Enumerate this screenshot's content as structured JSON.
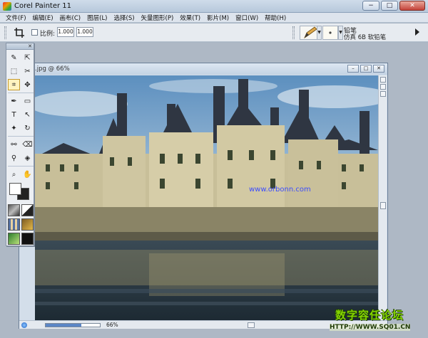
{
  "app": {
    "title": "Corel Painter 11",
    "window_buttons": {
      "minimize": "−",
      "maximize": "□",
      "close": "✕"
    }
  },
  "menu": {
    "items": [
      "文件(F)",
      "编辑(E)",
      "画布(C)",
      "图层(L)",
      "选择(S)",
      "矢量图形(P)",
      "效果(T)",
      "影片(M)",
      "窗口(W)",
      "帮助(H)"
    ]
  },
  "property_bar": {
    "ratio_label": "比例:",
    "width_value": "1.000",
    "height_value": "1.000",
    "brush_category": "铅笔",
    "brush_variant": "仿真 6B 软铅笔"
  },
  "document": {
    "title": ".jpg @ 66%",
    "zoom_text": "66%",
    "zoom_level": 0.66,
    "buttons": {
      "minimize": "–",
      "restore": "□",
      "close": "✕"
    }
  },
  "toolbox": {
    "close_label": "✕",
    "tools": [
      {
        "name": "brush-tool",
        "glyph": "✎"
      },
      {
        "name": "eyedropper-tool",
        "glyph": "⇱"
      },
      {
        "name": "rect-select-tool",
        "glyph": "⬚"
      },
      {
        "name": "lasso-tool",
        "glyph": "✂"
      },
      {
        "name": "crop-tool",
        "glyph": "⌗"
      },
      {
        "name": "layer-adjuster-tool",
        "glyph": "✥"
      },
      {
        "name": "pen-tool",
        "glyph": "✒"
      },
      {
        "name": "rectangle-shape-tool",
        "glyph": "▭"
      },
      {
        "name": "text-tool",
        "glyph": "T"
      },
      {
        "name": "shape-selection-tool",
        "glyph": "↖"
      },
      {
        "name": "magic-wand-tool",
        "glyph": "✦"
      },
      {
        "name": "rotate-page-tool",
        "glyph": "↻"
      },
      {
        "name": "cloner-tool",
        "glyph": "⚯"
      },
      {
        "name": "eraser-tool",
        "glyph": "⌫"
      },
      {
        "name": "dropper-tool",
        "glyph": "⚲"
      },
      {
        "name": "paint-bucket-tool",
        "glyph": "◈"
      },
      {
        "name": "magnifier-tool",
        "glyph": "⌕"
      },
      {
        "name": "grabber-tool",
        "glyph": "✋"
      }
    ],
    "colors": {
      "main": "#ffffff",
      "additional": "#222222"
    }
  },
  "watermarks": {
    "url": "www.orbonn.com",
    "logo_text": "数字容任论坛",
    "site_text": "HTTP://WWW.SQ01.CN"
  },
  "colors": {
    "titlebar": "#c3d2e3",
    "workspace": "#aeb8c5",
    "sky": "#6f9fc9",
    "castle_stone": "#c8bf99",
    "roof": "#2f3642",
    "water": "#25323d"
  }
}
